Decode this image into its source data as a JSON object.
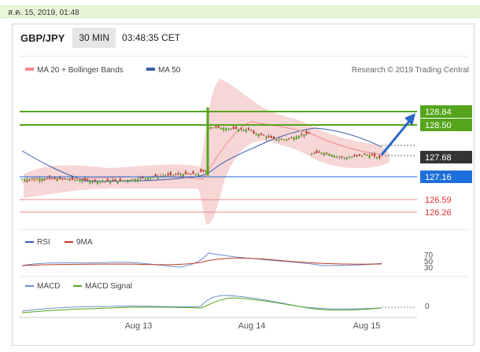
{
  "timestamp": "ส.ค. 15, 2019, 01:48",
  "header": {
    "symbol": "GBP/JPY",
    "timeframe": "30 MIN",
    "time": "03:48:35 CET"
  },
  "legend": {
    "ma20": "MA 20 + Bollinger Bands",
    "ma50": "MA 50",
    "credit": "Research © 2019 Trading Central"
  },
  "levels": [
    {
      "label": "128.84",
      "value": 128.84,
      "kind": "resistance",
      "color": "#55a51c"
    },
    {
      "label": "128.50",
      "value": 128.5,
      "kind": "resistance",
      "color": "#55a51c"
    },
    {
      "label": "127.68",
      "value": 127.68,
      "kind": "last",
      "color": "#333333"
    },
    {
      "label": "127.16",
      "value": 127.16,
      "kind": "pivot",
      "color": "#1e6fd9"
    },
    {
      "label": "126.59",
      "value": 126.59,
      "kind": "support",
      "color": "#e03030"
    },
    {
      "label": "126.26",
      "value": 126.26,
      "kind": "support",
      "color": "#e03030"
    }
  ],
  "rsi": {
    "label": "RSI",
    "ma_label": "9MA",
    "levels": [
      "70",
      "50",
      "30"
    ]
  },
  "macd": {
    "label": "MACD",
    "signal_label": "MACD Signal",
    "zero": "0"
  },
  "xaxis": [
    "Aug 13",
    "Aug 14",
    "Aug 15"
  ],
  "colors": {
    "candle_up": "#55a51c",
    "candle_down": "#c23b22",
    "bands": "#f6cfcf",
    "ma50": "#3a5ea8"
  }
}
